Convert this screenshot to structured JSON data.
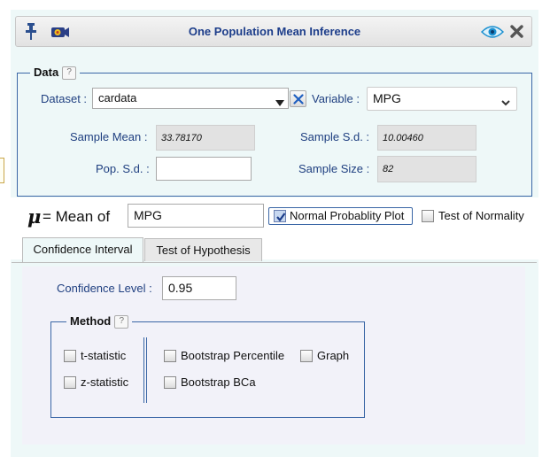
{
  "window": {
    "title": "One Population Mean Inference",
    "pin_icon": "pin-icon",
    "camera_icon": "camera-icon",
    "eye_icon": "eye-icon",
    "close_icon": "close-icon"
  },
  "data_section": {
    "legend": "Data",
    "help": "?",
    "dataset_label": "Dataset :",
    "dataset_value": "cardata",
    "variable_label": "Variable :",
    "variable_value": "MPG",
    "sample_mean_label": "Sample Mean :",
    "sample_mean_value": "33.78170",
    "sample_sd_label": "Sample S.d. :",
    "sample_sd_value": "10.00460",
    "pop_sd_label": "Pop. S.d. :",
    "pop_sd_value": "",
    "sample_size_label": "Sample Size :",
    "sample_size_value": "82"
  },
  "mean_row": {
    "mu_symbol": "μ",
    "label": "= Mean of",
    "value": "MPG",
    "normal_plot_label": "Normal Probablity Plot",
    "normal_plot_checked": true,
    "normality_test_label": "Test of Normality",
    "normality_test_checked": false
  },
  "tabs": [
    {
      "label": "Confidence Interval",
      "active": true
    },
    {
      "label": "Test of Hypothesis",
      "active": false
    }
  ],
  "ci": {
    "level_label": "Confidence Level :",
    "level_value": "0.95"
  },
  "method": {
    "legend": "Method",
    "help": "?",
    "t_stat": "t-statistic",
    "z_stat": "z-statistic",
    "boot_percentile": "Bootstrap Percentile",
    "boot_bca": "Bootstrap BCa",
    "graph": "Graph"
  },
  "colors": {
    "accent": "#3a66a6",
    "title": "#1c3d8a",
    "panel_bg": "#eef8f8"
  }
}
